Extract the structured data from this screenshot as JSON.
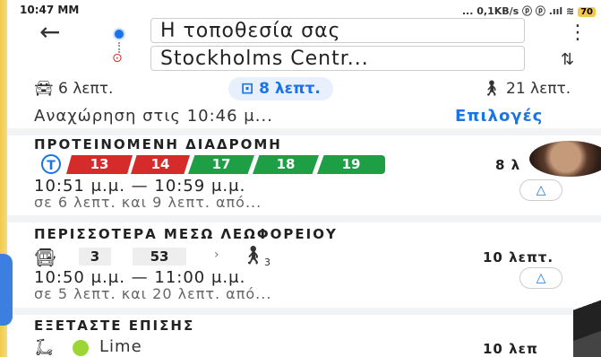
{
  "status": {
    "time": "10:47 MM",
    "right": "... 0,1KB/s ⓟ ⓟ .ııl ≋",
    "battery": "70"
  },
  "route": {
    "origin": "Η τοποθεσία σας",
    "destination": "Stockholms Centr..."
  },
  "modes": {
    "car": "6 λεπτ.",
    "transit": "8 λεπτ.",
    "walk": "21 λεπτ."
  },
  "departure": {
    "text": "Αναχώρηση στις 10:46 μ...",
    "options": "Επιλογές"
  },
  "recommended": {
    "title": "ΠΡΟΤΕΙΝΟΜΕΝΗ ΔΙΑΔΡΟΜΗ",
    "lines": [
      "13",
      "14",
      "17",
      "18",
      "19"
    ],
    "duration": "8 λ",
    "time": "10:51 μ.μ. — 10:59 μ.μ.",
    "detail": "σε 6 λεπτ. και 9 λεπτ. από..."
  },
  "bus": {
    "title": "ΠΕΡΙΣΣΟΤΕΡΑ ΜΕΣΩ ΛΕΩΦΟΡΕΙΟΥ",
    "lines": [
      "3",
      "53"
    ],
    "walk_count": "3",
    "duration": "10 λεπτ.",
    "time": "10:50 μ.μ. — 11:00 μ.μ.",
    "detail": "σε 5 λεπτ. και 20 λεπτ. από..."
  },
  "also": {
    "title": "ΕΞΕΤΑΣΤΕ ΕΠΙΣΗΣ",
    "provider": "Lime",
    "duration": "10 λεπ"
  },
  "colors": {
    "accent": "#1a73e8",
    "red_line": "#d62b2b",
    "green_line": "#1e9e45"
  }
}
